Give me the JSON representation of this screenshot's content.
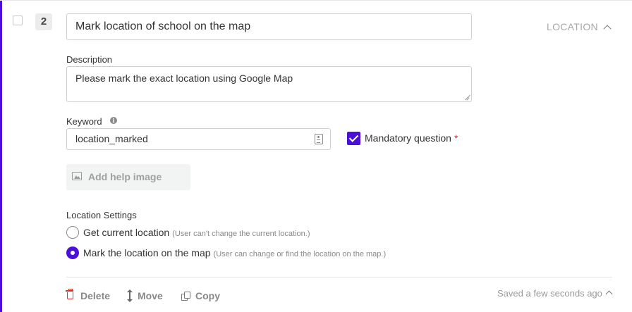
{
  "question": {
    "number": "2",
    "title": "Mark location of school on the map",
    "type_label": "LOCATION"
  },
  "description": {
    "label": "Description",
    "value": "Please mark the exact location using Google Map"
  },
  "keyword": {
    "label": "Keyword",
    "value": "location_marked"
  },
  "mandatory": {
    "label": "Mandatory question",
    "marker": "*",
    "checked": true
  },
  "help_image": {
    "label": "Add help image"
  },
  "location_settings": {
    "label": "Location Settings",
    "options": [
      {
        "label": "Get current location",
        "hint": "(User can't change the current location.)",
        "selected": false
      },
      {
        "label": "Mark the location on the map",
        "hint": "(User can change or find the location on the map.)",
        "selected": true
      }
    ]
  },
  "footer": {
    "delete_label": "Delete",
    "move_label": "Move",
    "copy_label": "Copy",
    "saved_status": "Saved a few seconds ago"
  },
  "colors": {
    "accent": "#4a10d8",
    "danger": "#e2302f"
  }
}
